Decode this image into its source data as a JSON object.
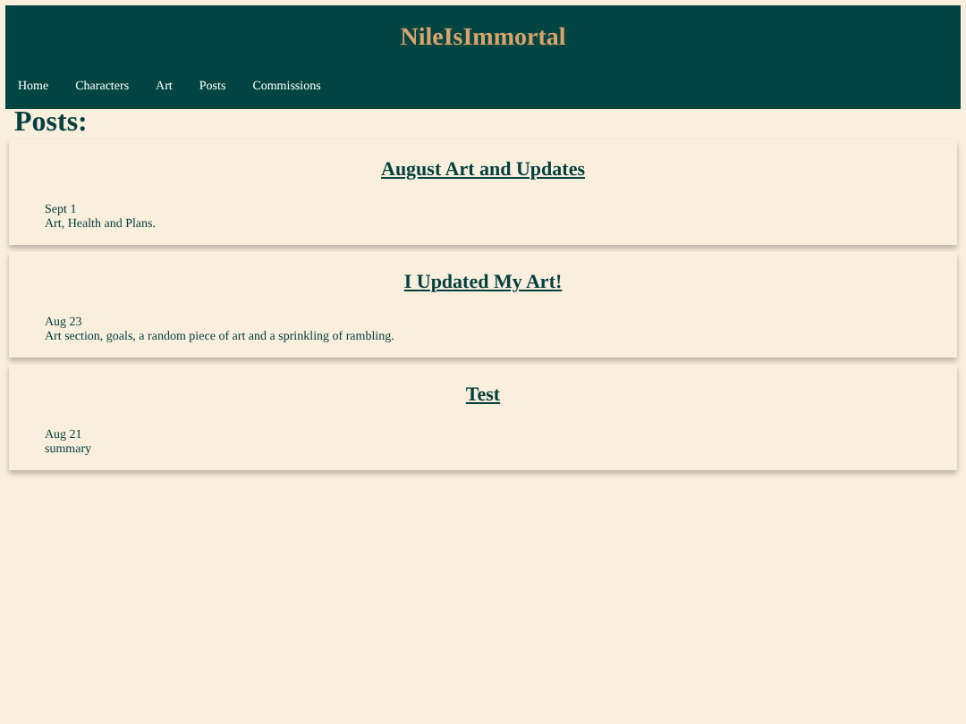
{
  "site": {
    "title": "NileIsImmortal"
  },
  "nav": [
    "Home",
    "Characters",
    "Art",
    "Posts",
    "Commissions"
  ],
  "heading": "Posts:",
  "posts": [
    {
      "title": "August Art and Updates",
      "date": "Sept 1",
      "summary": "Art, Health and Plans."
    },
    {
      "title": "I Updated My Art!",
      "date": "Aug 23",
      "summary": "Art section, goals, a random piece of art and a sprinkling of rambling."
    },
    {
      "title": "Test",
      "date": "Aug 21",
      "summary": "summary"
    }
  ]
}
